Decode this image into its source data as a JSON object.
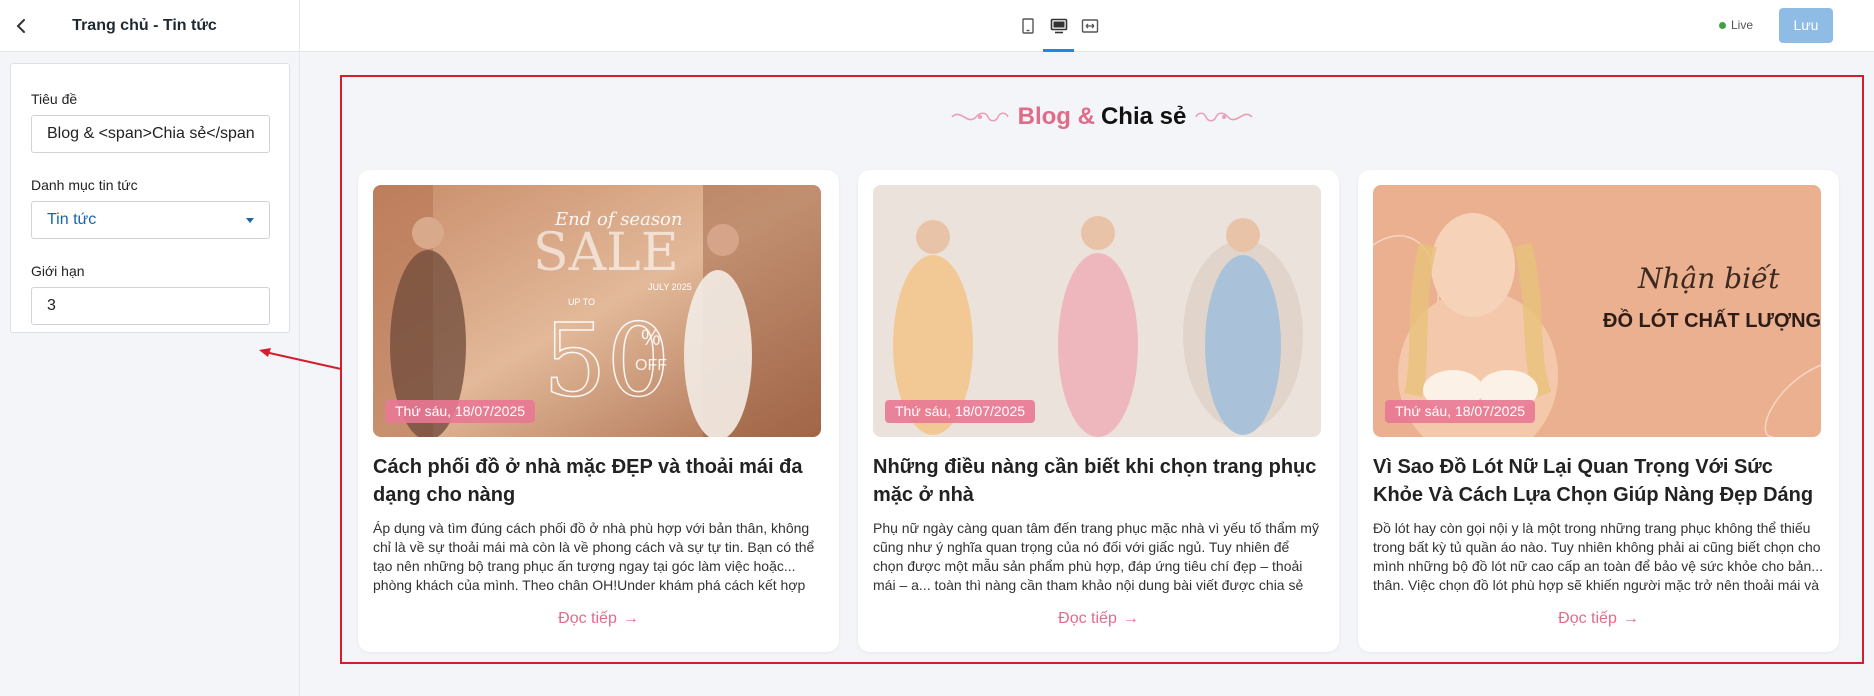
{
  "sidebar": {
    "title": "Trang chủ - Tin tức",
    "fields": {
      "title_label": "Tiêu đề",
      "title_value": "Blog & <span>Chia sẻ</span>",
      "category_label": "Danh mục tin tức",
      "category_value": "Tin tức",
      "limit_label": "Giới hạn",
      "limit_value": "3"
    }
  },
  "topbar": {
    "devices": [
      "mobile-icon",
      "desktop-icon",
      "fullwidth-icon"
    ],
    "active_device": "desktop-icon",
    "live_label": "Live",
    "save_label": "Lưu"
  },
  "preview": {
    "title_pink": "Blog &",
    "title_dark": "Chia sẻ",
    "colors": {
      "accent": "#e06c8a",
      "frame": "#d21f2b"
    },
    "cards": [
      {
        "date": "Thứ sáu, 18/07/2025",
        "title": "Cách phối đồ ở nhà mặc ĐẸP và thoải mái đa dạng cho nàng",
        "excerpt": "Áp dụng và tìm đúng cách phối đồ ở nhà phù hợp với bản thân, không chỉ là về sự thoải mái mà còn là về phong cách và sự tự tin. Bạn có thể tạo nên những bộ trang phục ấn tượng ngay tại góc làm việc hoặc... phòng khách của mình. Theo chân OH!Under khám phá cách kết hợp",
        "link": "Đọc tiếp",
        "img_text": {
          "line1": "End of season",
          "line2": "SALE",
          "line3": "UP TO",
          "line4": "50",
          "line5": "JULY 2025",
          "line6": "%",
          "line7": "OFF"
        }
      },
      {
        "date": "Thứ sáu, 18/07/2025",
        "title": "Những điều nàng cần biết khi chọn trang phục mặc ở nhà",
        "excerpt": "Phụ nữ ngày càng quan tâm đến trang phục mặc nhà vì yếu tố thẩm mỹ cũng như ý nghĩa quan trọng của nó đối với giấc ngủ. Tuy nhiên để chọn được một mẫu sản phẩm phù hợp, đáp ứng tiêu chí đẹp – thoải mái – a... toàn thì nàng cần tham khảo nội dung bài viết được chia sẻ sau đây. Ý",
        "link": "Đọc tiếp"
      },
      {
        "date": "Thứ sáu, 18/07/2025",
        "title": "Vì Sao Đồ Lót Nữ Lại Quan Trọng Với Sức Khỏe Và Cách Lựa Chọn Giúp Nàng Đẹp Dáng",
        "excerpt": "Đồ lót hay còn gọi nội y là một trong những trang phục không thể thiếu trong bất kỳ tủ quần áo nào. Tuy nhiên không phải ai cũng biết chọn cho mình những bộ đồ lót nữ cao cấp an toàn để bảo vệ sức khỏe cho bản... thân. Việc chọn đồ lót phù hợp sẽ khiến người mặc trở nên thoải mái và",
        "link": "Đọc tiếp",
        "img_text": {
          "line1": "Nhận biết",
          "line2": "ĐỒ LÓT CHẤT LƯỢNG"
        }
      }
    ]
  }
}
